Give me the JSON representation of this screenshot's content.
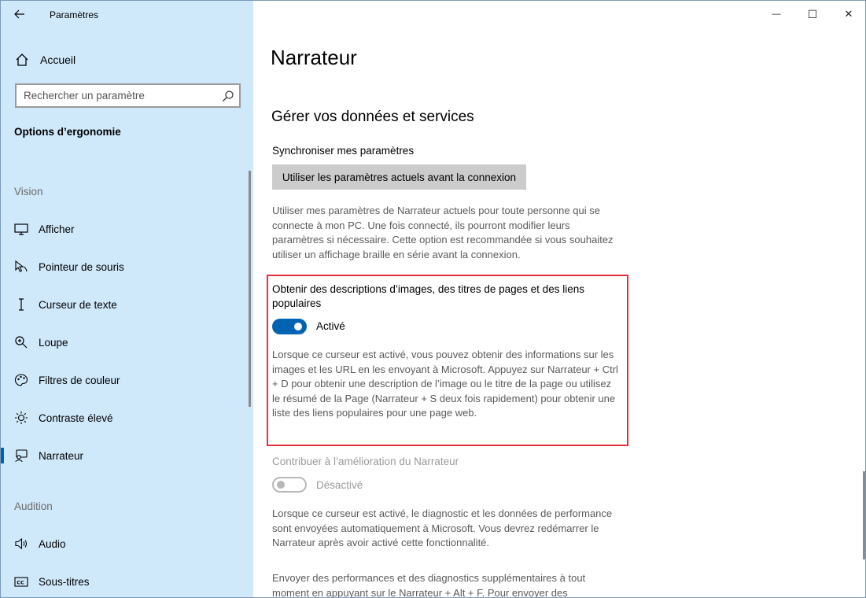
{
  "window": {
    "app_title": "Paramètres",
    "back_icon": "back-arrow-icon",
    "minimize_glyph": "—",
    "maximize_glyph": "☐",
    "close_glyph": "✕"
  },
  "sidebar": {
    "home_label": "Accueil",
    "search_placeholder": "Rechercher un paramètre",
    "section_title": "Options d’ergonomie",
    "groups": [
      {
        "label": "Vision",
        "items": [
          {
            "label": "Afficher",
            "icon": "monitor-icon"
          },
          {
            "label": "Pointeur de souris",
            "icon": "mouse-pointer-icon"
          },
          {
            "label": "Curseur de texte",
            "icon": "text-cursor-icon"
          },
          {
            "label": "Loupe",
            "icon": "magnifier-icon"
          },
          {
            "label": "Filtres de couleur",
            "icon": "color-filter-icon"
          },
          {
            "label": "Contraste élevé",
            "icon": "brightness-icon"
          },
          {
            "label": "Narrateur",
            "icon": "narrator-icon",
            "active": true
          }
        ]
      },
      {
        "label": "Audition",
        "items": [
          {
            "label": "Audio",
            "icon": "speaker-icon"
          },
          {
            "label": "Sous-titres",
            "icon": "closed-captions-icon"
          }
        ]
      }
    ]
  },
  "main": {
    "page_title": "Narrateur",
    "section_title": "Gérer vos données et services",
    "sync": {
      "label": "Synchroniser mes paramètres",
      "button_label": "Utiliser les paramètres actuels avant la connexion",
      "description": "Utiliser mes paramètres de Narrateur actuels pour toute personne qui se connecte à mon PC. Une fois connecté, ils pourront modifier leurs paramètres si nécessaire. Cette option est recommandée si vous souhaitez utiliser un affichage braille en série avant la connexion."
    },
    "image_descriptions": {
      "label": "Obtenir des descriptions d’images, des titres de pages et des liens populaires",
      "toggle_on": true,
      "toggle_state": "Activé",
      "description": "Lorsque ce curseur est activé, vous pouvez obtenir des informations sur les images et les URL en les envoyant à Microsoft. Appuyez sur Narrateur + Ctrl + D pour obtenir une description de l’image ou le titre de la page ou utilisez le résumé de la Page (Narrateur + S deux fois rapidement) pour obtenir une liste des liens populaires pour une page web."
    },
    "improve_narrator": {
      "label": "Contribuer à l’amélioration du Narrateur",
      "toggle_on": false,
      "toggle_state": "Désactivé",
      "description": "Lorsque ce curseur est activé, le diagnostic et les données de performance sont envoyées automatiquement à Microsoft. Vous devrez redémarrer le Narrateur après avoir activé cette fonctionnalité."
    },
    "extra_description": "Envoyer des performances et des diagnostics supplémentaires à tout moment en appuyant sur le Narrateur + Alt + F. Pour envoyer des"
  },
  "colors": {
    "sidebar_bg": "#cfe8fa",
    "accent": "#0063b1",
    "highlight_border": "#e0313a"
  }
}
